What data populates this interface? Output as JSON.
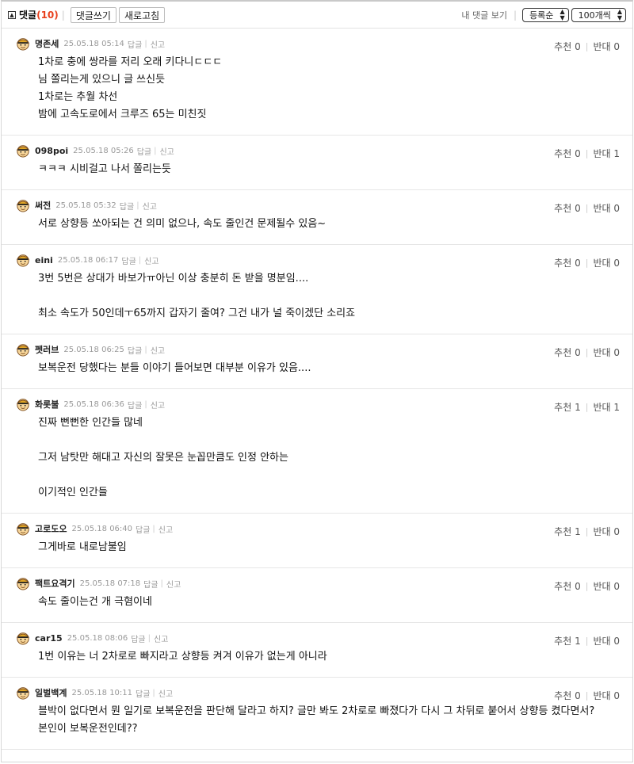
{
  "toolbar": {
    "title": "댓글",
    "count": "(10)",
    "write_label": "댓글쓰기",
    "refresh_label": "새로고침",
    "my_comments_label": "내 댓글 보기",
    "sort_value": "등록순",
    "per_page_value": "100개씩"
  },
  "comments": [
    {
      "nick": "명존세",
      "date": "25.05.18 05:14",
      "reply": "답글",
      "report": "신고",
      "up_label": "추천",
      "up": "0",
      "down_label": "반대",
      "down": "0",
      "lines": [
        "1차로 충에 쌍라를 저리 오래 키다니ㄷㄷㄷ",
        "님 쫄리는게 있으니 글 쓰신듯",
        "1차로는 추월 차선",
        "밤에 고속도로에서 크루즈 65는 미친짓"
      ]
    },
    {
      "nick": "098poi",
      "date": "25.05.18 05:26",
      "reply": "답글",
      "report": "신고",
      "up_label": "추천",
      "up": "0",
      "down_label": "반대",
      "down": "1",
      "lines": [
        "ㅋㅋㅋ 시비걸고 나서 쫄리는듯"
      ]
    },
    {
      "nick": "써전",
      "date": "25.05.18 05:32",
      "reply": "답글",
      "report": "신고",
      "up_label": "추천",
      "up": "0",
      "down_label": "반대",
      "down": "0",
      "lines": [
        "서로 상향등 쏘아되는 건 의미 없으나, 속도 줄인건 문제될수 있음~"
      ]
    },
    {
      "nick": "eini",
      "date": "25.05.18 06:17",
      "reply": "답글",
      "report": "신고",
      "up_label": "추천",
      "up": "0",
      "down_label": "반대",
      "down": "0",
      "lines": [
        "3번 5번은 상대가 바보가ㅠ아닌 이상 충분히 돈 받을 명분임....",
        "",
        "최소 속도가 50인데ㅜ65까지 갑자기 줄여? 그건 내가 널 죽이겠단 소리죠"
      ]
    },
    {
      "nick": "펫러브",
      "date": "25.05.18 06:25",
      "reply": "답글",
      "report": "신고",
      "up_label": "추천",
      "up": "0",
      "down_label": "반대",
      "down": "0",
      "lines": [
        "보복운전 당했다는 분들 이야기 들어보면 대부분 이유가 있음...."
      ]
    },
    {
      "nick": "화롯불",
      "date": "25.05.18 06:36",
      "reply": "답글",
      "report": "신고",
      "up_label": "추천",
      "up": "1",
      "down_label": "반대",
      "down": "1",
      "lines": [
        "진짜 뻔뻔한 인간들 많네",
        "",
        "그저 남탓만 해대고 자신의 잘못은 눈꼽만큼도 인정 안하는",
        "",
        "이기적인 인간들"
      ]
    },
    {
      "nick": "고로도오",
      "date": "25.05.18 06:40",
      "reply": "답글",
      "report": "신고",
      "up_label": "추천",
      "up": "1",
      "down_label": "반대",
      "down": "0",
      "lines": [
        "그게바로 내로남불임"
      ]
    },
    {
      "nick": "팩트요격기",
      "date": "25.05.18 07:18",
      "reply": "답글",
      "report": "신고",
      "up_label": "추천",
      "up": "0",
      "down_label": "반대",
      "down": "0",
      "lines": [
        "속도 줄이는건 개 극혐이네"
      ]
    },
    {
      "nick": "car15",
      "date": "25.05.18 08:06",
      "reply": "답글",
      "report": "신고",
      "up_label": "추천",
      "up": "1",
      "down_label": "반대",
      "down": "0",
      "lines": [
        "1번 이유는 너 2차로로 빠지라고 상향등 켜겨 이유가 없는게 아니라"
      ]
    },
    {
      "nick": "일벌백계",
      "date": "25.05.18 10:11",
      "reply": "답글",
      "report": "신고",
      "up_label": "추천",
      "up": "0",
      "down_label": "반대",
      "down": "0",
      "lines": [
        "블박이 없다면서 뭔 일기로 보복운전을 판단해 달라고 하지? 글만 봐도 2차로로 빠졌다가 다시 그 차뒤로 붙어서 상향등 켰다면서?",
        "본인이 보복운전인데??"
      ]
    }
  ],
  "avatar_colors": [
    "#e0a526",
    "#7a4a1a",
    "#f4d26b"
  ]
}
